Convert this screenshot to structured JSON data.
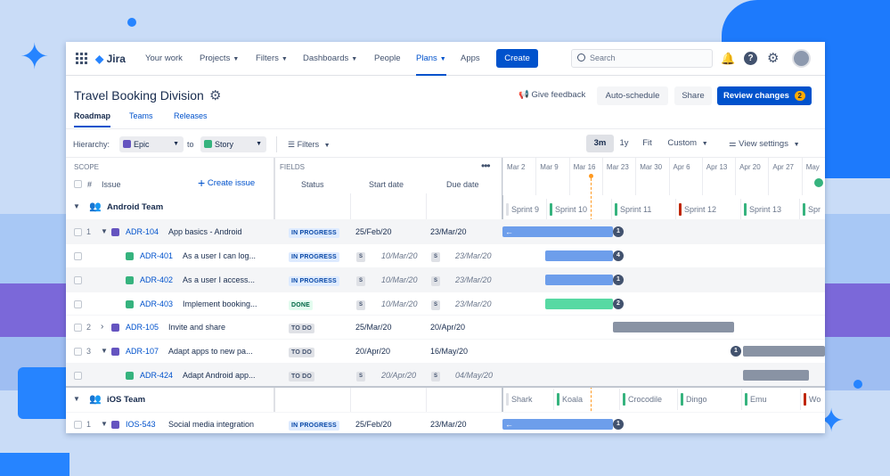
{
  "nav": {
    "logo": "Jira",
    "items": [
      "Your work",
      "Projects",
      "Filters",
      "Dashboards",
      "People",
      "Plans",
      "Apps"
    ],
    "create": "Create",
    "search_placeholder": "Search"
  },
  "header": {
    "title": "Travel Booking Division",
    "feedback": "Give feedback",
    "autoschedule": "Auto-schedule",
    "share": "Share",
    "review": "Review changes",
    "review_count": "2",
    "tabs": [
      "Roadmap",
      "Teams",
      "Releases"
    ]
  },
  "toolbar": {
    "hierarchy_label": "Hierarchy:",
    "from": "Epic",
    "to_label": "to",
    "to": "Story",
    "filters": "Filters",
    "zoom": [
      "3m",
      "1y",
      "Fit",
      "Custom"
    ],
    "view_settings": "View settings"
  },
  "table": {
    "scope": "SCOPE",
    "hash": "#",
    "issue": "Issue",
    "create_issue": "Create issue",
    "fields": "FIELDS",
    "status": "Status",
    "start": "Start date",
    "due": "Due date"
  },
  "timeline": {
    "dates": [
      "Mar 2",
      "Mar 9",
      "Mar 16",
      "Mar 23",
      "Mar 30",
      "Apr 6",
      "Apr 13",
      "Apr 20",
      "Apr 27",
      "May"
    ],
    "android_sprints": [
      {
        "name": "Sprint 9",
        "color": "#dfe1e6"
      },
      {
        "name": "Sprint 10",
        "color": "#36b37e"
      },
      {
        "name": "Sprint 11",
        "color": "#36b37e"
      },
      {
        "name": "Sprint 12",
        "color": "#bf2600"
      },
      {
        "name": "Sprint 13",
        "color": "#36b37e"
      },
      {
        "name": "Spr",
        "color": "#36b37e"
      }
    ],
    "ios_sprints": [
      {
        "name": "Shark",
        "color": "#dfe1e6"
      },
      {
        "name": "Koala",
        "color": "#36b37e"
      },
      {
        "name": "Crocodile",
        "color": "#36b37e"
      },
      {
        "name": "Dingo",
        "color": "#36b37e"
      },
      {
        "name": "Emu",
        "color": "#36b37e"
      },
      {
        "name": "Wo",
        "color": "#bf2600"
      }
    ]
  },
  "groups": [
    {
      "name": "Android Team"
    },
    {
      "name": "iOS Team"
    }
  ],
  "rows": [
    {
      "num": "1",
      "key": "ADR-104",
      "title": "App basics - Android",
      "type": "epic",
      "status": "IN PROGRESS",
      "start": "25/Feb/20",
      "due": "23/Mar/20",
      "child": false,
      "expand": "v",
      "count": "1"
    },
    {
      "num": "",
      "key": "ADR-401",
      "title": "As a user I can log...",
      "type": "story",
      "status": "IN PROGRESS",
      "start": "10/Mar/20",
      "due": "23/Mar/20",
      "child": true,
      "expand": "",
      "count": "4"
    },
    {
      "num": "",
      "key": "ADR-402",
      "title": "As a user I access...",
      "type": "story",
      "status": "IN PROGRESS",
      "start": "10/Mar/20",
      "due": "23/Mar/20",
      "child": true,
      "expand": "",
      "count": "1"
    },
    {
      "num": "",
      "key": "ADR-403",
      "title": "Implement booking...",
      "type": "story",
      "status": "DONE",
      "start": "10/Mar/20",
      "due": "23/Mar/20",
      "child": true,
      "expand": "",
      "count": "2"
    },
    {
      "num": "2",
      "key": "ADR-105",
      "title": "Invite and share",
      "type": "epic",
      "status": "TO DO",
      "start": "25/Mar/20",
      "due": "20/Apr/20",
      "child": false,
      "expand": ">",
      "count": ""
    },
    {
      "num": "3",
      "key": "ADR-107",
      "title": "Adapt apps to new pa...",
      "type": "epic",
      "status": "TO DO",
      "start": "20/Apr/20",
      "due": "16/May/20",
      "child": false,
      "expand": "v",
      "count": "1"
    },
    {
      "num": "",
      "key": "ADR-424",
      "title": "Adapt Android app...",
      "type": "story",
      "status": "TO DO",
      "start": "20/Apr/20",
      "due": "04/May/20",
      "child": true,
      "expand": "",
      "count": ""
    },
    {
      "num": "1",
      "key": "IOS-543",
      "title": "Social media integration",
      "type": "epic",
      "status": "IN PROGRESS",
      "start": "25/Feb/20",
      "due": "23/Mar/20",
      "child": false,
      "expand": "v",
      "count": "1"
    }
  ],
  "colors": {
    "primary": "#0052cc",
    "inprogress_bg": "#deebff",
    "inprogress_fg": "#0747a6",
    "done_bg": "#e3fcef",
    "done_fg": "#006644",
    "todo_bg": "#dfe1e6",
    "todo_fg": "#42526e",
    "bar_blue": "#6d9eeb",
    "bar_green": "#57d9a3",
    "bar_gray": "#8993a4",
    "today": "#ff991f"
  }
}
